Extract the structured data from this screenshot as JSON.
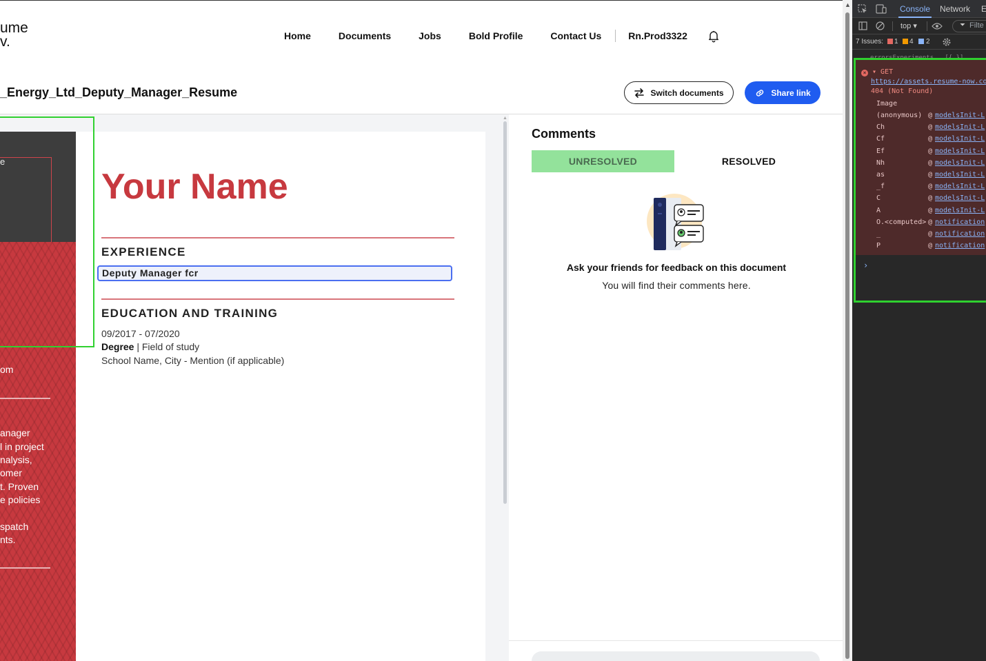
{
  "header": {
    "logo_line1": "ume",
    "logo_line2": "v.",
    "nav": [
      "Home",
      "Documents",
      "Jobs",
      "Bold Profile",
      "Contact Us"
    ],
    "user": "Rn.Prod3322"
  },
  "toolbar": {
    "doc_title": "_Energy_Ltd_Deputy_Manager_Resume",
    "switch_label": "Switch documents",
    "share_label": "Share link"
  },
  "resume": {
    "name": "Your Name",
    "experience_heading": "EXPERIENCE",
    "experience_input": "Deputy Manager fcr",
    "education_heading": "EDUCATION AND TRAINING",
    "edu_dates": "09/2017 - 07/2020",
    "edu_degree": "Degree",
    "edu_field": " | Field of study",
    "edu_school": "School Name, City - Mention (if applicable)",
    "side_photo_text": "e",
    "side_contact": "om",
    "side_summary": [
      "anager",
      "l in project",
      "nalysis,",
      "omer",
      "t. Proven",
      "e policies",
      "",
      "spatch",
      "nts."
    ]
  },
  "comments": {
    "title": "Comments",
    "tab_unresolved": "UNRESOLVED",
    "tab_resolved": "RESOLVED",
    "empty_title": "Ask your friends for feedback on this document",
    "empty_sub": "You will find their comments here."
  },
  "devtools": {
    "tabs": [
      "Console",
      "Network",
      "E"
    ],
    "context": "top ▾",
    "filter": "Filte",
    "issues_label": "7 Issues:",
    "issue_counts": [
      "1",
      "4",
      "2"
    ],
    "prev_line": "errorsExperiments , [{…}]",
    "method": "▾ GET",
    "url": "https://assets.resume-now.co",
    "status": "404 (Not Found)",
    "type": "Image",
    "stack": [
      {
        "fn": "(anonymous)",
        "src": "modelsInit-L"
      },
      {
        "fn": "Ch",
        "src": "modelsInit-L"
      },
      {
        "fn": "Cf",
        "src": "modelsInit-L"
      },
      {
        "fn": "Ef",
        "src": "modelsInit-L"
      },
      {
        "fn": "Nh",
        "src": "modelsInit-L"
      },
      {
        "fn": "as",
        "src": "modelsInit-L"
      },
      {
        "fn": "_f",
        "src": "modelsInit-L"
      },
      {
        "fn": "C",
        "src": "modelsInit-L"
      },
      {
        "fn": "A",
        "src": "modelsInit-L"
      },
      {
        "fn": "O.<computed>",
        "src": "notification"
      },
      {
        "fn": "_",
        "src": "notification"
      },
      {
        "fn": "P",
        "src": "notification"
      }
    ],
    "prompt": "›"
  },
  "colors": {
    "accent_red": "#c7393f",
    "share_blue": "#1f5cf0",
    "unresolved_green": "#93e29b",
    "highlight_green": "#2fd12f"
  }
}
